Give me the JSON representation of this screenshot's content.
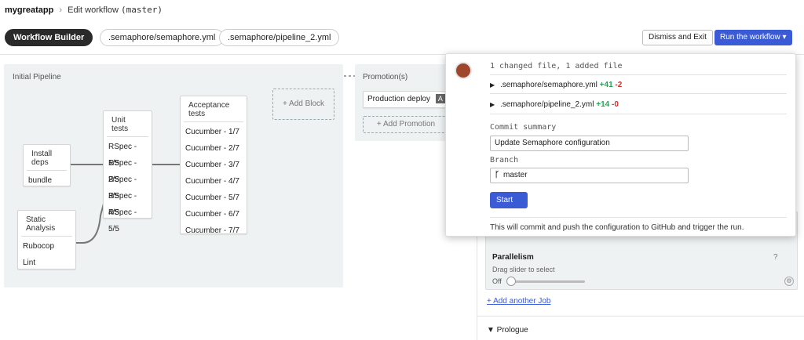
{
  "breadcrumb": {
    "project": "mygreatapp",
    "separator": "›",
    "page": "Edit workflow",
    "branch": "(master)"
  },
  "toolbar": {
    "builder_label": "Workflow Builder",
    "file_tabs": [
      ".semaphore/semaphore.yml",
      ".semaphore/pipeline_2.yml"
    ],
    "dismiss_label": "Dismiss and Exit",
    "run_label": "Run the workflow ▾"
  },
  "pipeline": {
    "title": "Initial Pipeline",
    "blocks": {
      "install": {
        "name": "Install deps",
        "jobs": [
          "bundle"
        ]
      },
      "static": {
        "name": "Static Analysis",
        "jobs": [
          "Rubocop",
          "Lint"
        ]
      },
      "unit": {
        "name": "Unit tests",
        "jobs": [
          "RSpec - 1/5",
          "RSpec - 2/5",
          "RSpec - 3/5",
          "RSpec - 4/5",
          "RSpec - 5/5"
        ]
      },
      "acceptance": {
        "name": "Acceptance tests",
        "jobs": [
          "Cucumber - 1/7",
          "Cucumber - 2/7",
          "Cucumber - 3/7",
          "Cucumber - 4/7",
          "Cucumber - 5/7",
          "Cucumber - 6/7",
          "Cucumber - 7/7"
        ]
      }
    },
    "add_block": "+ Add Block"
  },
  "promotions": {
    "title": "Promotion(s)",
    "item": "Production deploy",
    "badge": "A",
    "add": "+ Add Promotion"
  },
  "job_panel": {
    "parallelism_title": "Parallelism",
    "help": "?",
    "hint": "Drag slider to select",
    "slider_value": "Off",
    "add_job": "+ Add another Job",
    "prologue": "▼ Prologue"
  },
  "commit": {
    "summary_line": "1 changed file, 1 added file",
    "files": [
      {
        "name": ".semaphore/semaphore.yml",
        "added": "+41",
        "removed": "-2"
      },
      {
        "name": ".semaphore/pipeline_2.yml",
        "added": "+14",
        "removed": "-0"
      }
    ],
    "commit_label": "Commit summary",
    "commit_value": "Update Semaphore configuration",
    "branch_label": "Branch",
    "branch_value": "master",
    "start_label": "Start",
    "footer": "This will commit and push the configuration to GitHub and trigger the run."
  },
  "colors": {
    "accent": "#3b5bd6",
    "added": "#27a34f",
    "removed": "#d0312d",
    "canvas": "#eef2f2"
  }
}
